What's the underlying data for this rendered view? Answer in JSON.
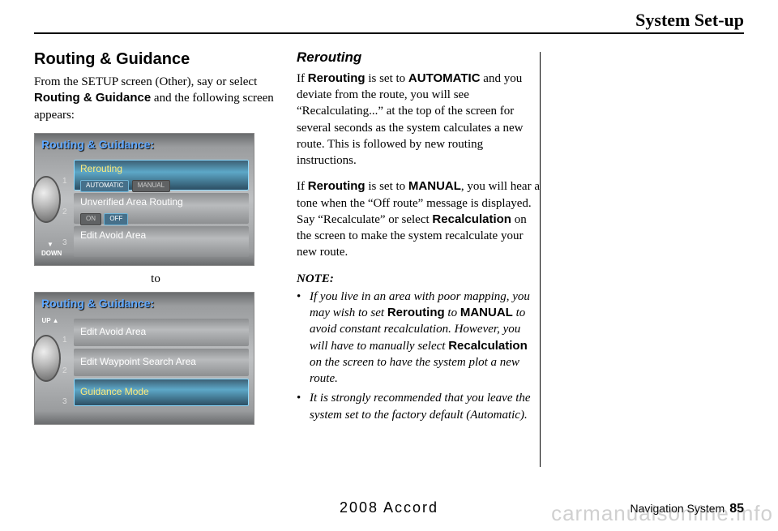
{
  "chapter_title": "System Set-up",
  "section_heading": "Routing & Guidance",
  "intro_text": "From the SETUP screen (Other), say or select Routing & Guidance and the following screen appears:",
  "intro_parts": {
    "pre": "From the ",
    "setup": "SETUP",
    "mid1": " screen (",
    "other": "Other",
    "mid2": "), say or select ",
    "rg": "Routing & Guidance",
    "post": " and the following screen appears:"
  },
  "to_label": "to",
  "shot_title": "Routing & Guidance:",
  "shot1": {
    "arrow": "▼\nDOWN",
    "nums": [
      "1",
      "2",
      "3"
    ],
    "rows": [
      {
        "label": "Rerouting",
        "opts": [
          "AUTOMATIC",
          "MANUAL"
        ],
        "active": 0,
        "sel": true
      },
      {
        "label": "Unverified Area Routing",
        "opts": [
          "ON",
          "OFF"
        ],
        "active": 1,
        "sel": false
      },
      {
        "label": "Edit Avoid Area",
        "sel": false
      }
    ]
  },
  "shot2": {
    "arrow": "UP\n▲",
    "nums": [
      "1",
      "2",
      "3"
    ],
    "rows": [
      {
        "label": "Edit Avoid Area",
        "sel": false
      },
      {
        "label": "Edit Waypoint Search Area",
        "sel": false
      },
      {
        "label": "Guidance Mode",
        "sel": true
      }
    ]
  },
  "sub_heading": "Rerouting",
  "para1": {
    "pre": "If ",
    "k1": "Rerouting",
    "mid1": " is set to ",
    "k2": "AUTOMATIC",
    "post": " and you deviate from the route, you will see “Recalculating...” at the top of the screen for several seconds as the system calculates a new route. This is followed by new routing instructions."
  },
  "para2": {
    "pre": "If ",
    "k1": "Rerouting",
    "mid1": " is set to ",
    "k2": "MANUAL",
    "mid2": ", you will hear a tone when the “Off route” message is displayed. Say “Recalculate” or select ",
    "k3": "Recalculation",
    "post": " on the screen to make the system recalculate your new route."
  },
  "note_heading": "NOTE:",
  "note1": {
    "a": "If you live in an area with poor mapping, you may wish to set ",
    "k1": "Rerouting",
    "b": " to ",
    "k2": "MANUAL",
    "c": " to avoid constant recalculation. However, you will have to manually select ",
    "k3": "Recalculation",
    "d": " on the screen to have the system plot a new route."
  },
  "note2": "It is strongly recommended that you leave the system set to the factory default (Automatic).",
  "model_year": "2008  Accord",
  "footer_label": "Navigation System",
  "page_number": "85",
  "watermark": "carmanualsonline.info"
}
